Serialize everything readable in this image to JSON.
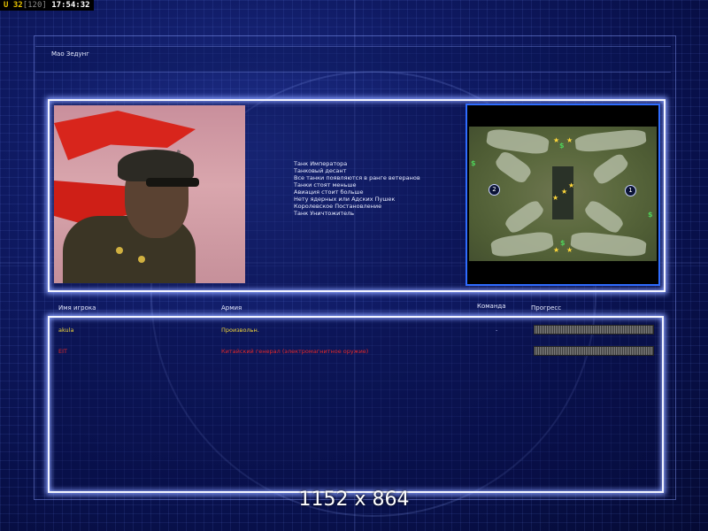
{
  "status_bar": {
    "label": "U",
    "value": "32",
    "bracket": "[120]",
    "time": "17:54:32"
  },
  "title": "Мао Зедунг",
  "info_lines": [
    "Танк Императора",
    "Танковый десант",
    "Все танки появляются в ранге ветеранов",
    "Танки стоят меньше",
    "Авиация стоит больше",
    "Нету ядерных или Адских Пушек",
    "Королевское Постановление",
    "Танк Уничтожитель"
  ],
  "minimap": {
    "start_markers": [
      "2",
      "1"
    ],
    "resource_icon": "$",
    "structure_icon": "★"
  },
  "columns": {
    "player": "Имя игрока",
    "army": "Армия",
    "team": "Команда",
    "progress": "Прогресс"
  },
  "players": [
    {
      "name": "akula",
      "army": "Произвольн.",
      "team": "-",
      "progress": 1.0,
      "color": "#f1d53a"
    },
    {
      "name": "EIT",
      "army": "Китайский генерал (электромагнитное оружие)",
      "team": "",
      "progress": 1.0,
      "color": "#e0282a"
    }
  ],
  "resolution_label": "1152 x 864",
  "colors": {
    "background": "#0f1a63",
    "panel_border": "#f2f4ff",
    "panel_glow": "#8aa0ff",
    "minimap_border": "#2f6cff"
  }
}
